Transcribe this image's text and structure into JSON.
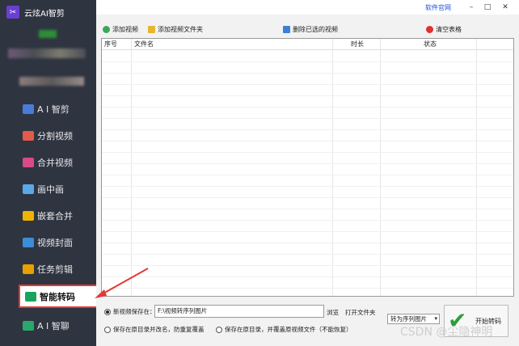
{
  "app": {
    "title": "云炫AI智剪"
  },
  "nav": [
    {
      "label": "A I 智剪",
      "icon": "ai-cut-icon",
      "color": "#4a7bd8"
    },
    {
      "label": "分割视频",
      "icon": "split-video-icon",
      "color": "#e25b4b"
    },
    {
      "label": "合并视频",
      "icon": "merge-video-icon",
      "color": "#d84a8a"
    },
    {
      "label": "画中画",
      "icon": "picture-in-picture-icon",
      "color": "#5aa9e6"
    },
    {
      "label": "嵌套合并",
      "icon": "nest-merge-icon",
      "color": "#f0b400"
    },
    {
      "label": "视频封面",
      "icon": "video-cover-icon",
      "color": "#3c8dd8"
    },
    {
      "label": "任务剪辑",
      "icon": "task-edit-icon",
      "color": "#e8a000"
    },
    {
      "label": "智能转码",
      "icon": "smart-transcode-icon",
      "color": "#1aa35c",
      "active": true
    },
    {
      "label": "A I 智聊",
      "icon": "ai-chat-icon",
      "color": "#28a86b"
    }
  ],
  "window": {
    "software_link": "软件官网",
    "minimize": "–",
    "maximize": "□",
    "close": "✕"
  },
  "toolbar": {
    "add_video": "添加视频",
    "add_folder": "添加视频文件夹",
    "delete_selected": "删除已选的视频",
    "clear_table": "清空表格"
  },
  "table": {
    "columns": [
      "序号",
      "文件名",
      "时长",
      "状态"
    ]
  },
  "bottom": {
    "save_new_label": "新视频保存在：",
    "path_value": "F:\\视频转序列图片",
    "browse": "浏览",
    "open_folder": "打开文件夹",
    "keep_original_rename": "保存在原目录并改名，防重复覆盖",
    "keep_original_overwrite": "保存在原目录，并覆盖原视频文件（不能恢复）",
    "convert_select": "转为序列图片",
    "start_button": "开始转码"
  },
  "watermark": "CSDN @尘隐神明"
}
